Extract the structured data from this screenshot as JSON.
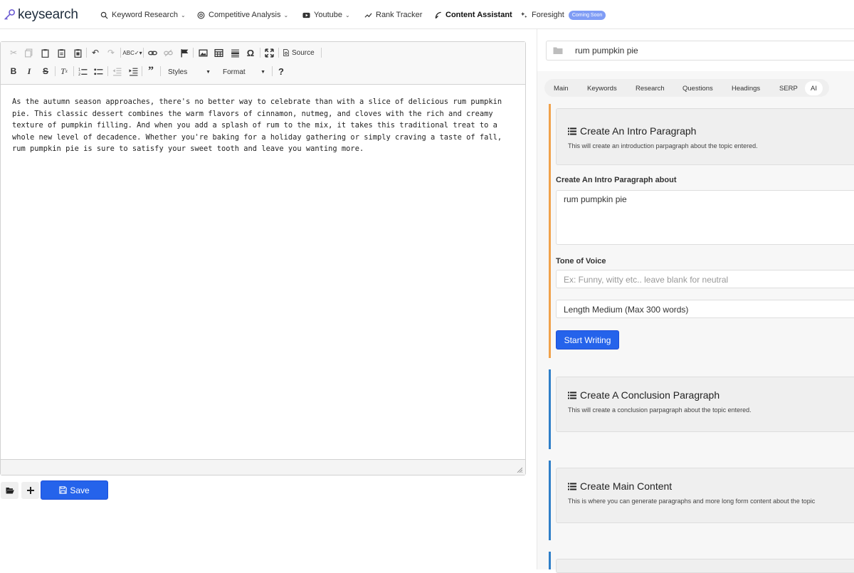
{
  "nav": {
    "logo": "keysearch",
    "items": [
      {
        "label": "Keyword Research",
        "dropdown": true
      },
      {
        "label": "Competitive Analysis",
        "dropdown": true
      },
      {
        "label": "Youtube",
        "dropdown": true
      },
      {
        "label": "Rank Tracker",
        "dropdown": false
      },
      {
        "label": "Content Assistant",
        "dropdown": false,
        "active": true
      },
      {
        "label": "Foresight",
        "dropdown": false,
        "badge": "Coming Soon"
      }
    ]
  },
  "editor": {
    "toolbar": {
      "source_label": "Source",
      "styles_label": "Styles",
      "format_label": "Format",
      "help_label": "?"
    },
    "content": "As the autumn season approaches, there's no better way to celebrate than with a slice of delicious rum pumpkin pie. This classic dessert combines the warm flavors of cinnamon, nutmeg, and cloves with the rich and creamy texture of pumpkin filling. And when you add a splash of rum to the mix, it takes this traditional treat to a whole new level of decadence. Whether you're baking for a holiday gathering or simply craving a taste of fall, rum pumpkin pie is sure to satisfy your sweet tooth and leave you wanting more.",
    "save_label": "Save"
  },
  "panel": {
    "keyword": "rum pumpkin pie",
    "tabs": [
      "Main",
      "Keywords",
      "Research",
      "Questions",
      "Headings",
      "SERP",
      "AI"
    ],
    "active_tab": "AI",
    "intro_card": {
      "title": "Create An Intro Paragraph",
      "description": "This will create an introduction parpagraph about the topic entered.",
      "topic_label": "Create An Intro Paragraph about",
      "topic_value": "rum pumpkin pie",
      "tone_label": "Tone of Voice",
      "tone_placeholder": "Ex: Funny, witty etc.. leave blank for neutral",
      "length_value": "Length Medium (Max 300 words)",
      "start_label": "Start Writing"
    },
    "conclusion_card": {
      "title": "Create A Conclusion Paragraph",
      "description": "This will create a conclusion parpagraph about the topic entered."
    },
    "main_card": {
      "title": "Create Main Content",
      "description": "This is where you can generate paragraphs and more long form content about the topic"
    }
  },
  "colors": {
    "accent_blue": "#2563eb",
    "accent_orange": "#f0a24b",
    "card_blue": "#2f7fc8",
    "badge": "#7f9cf5"
  }
}
